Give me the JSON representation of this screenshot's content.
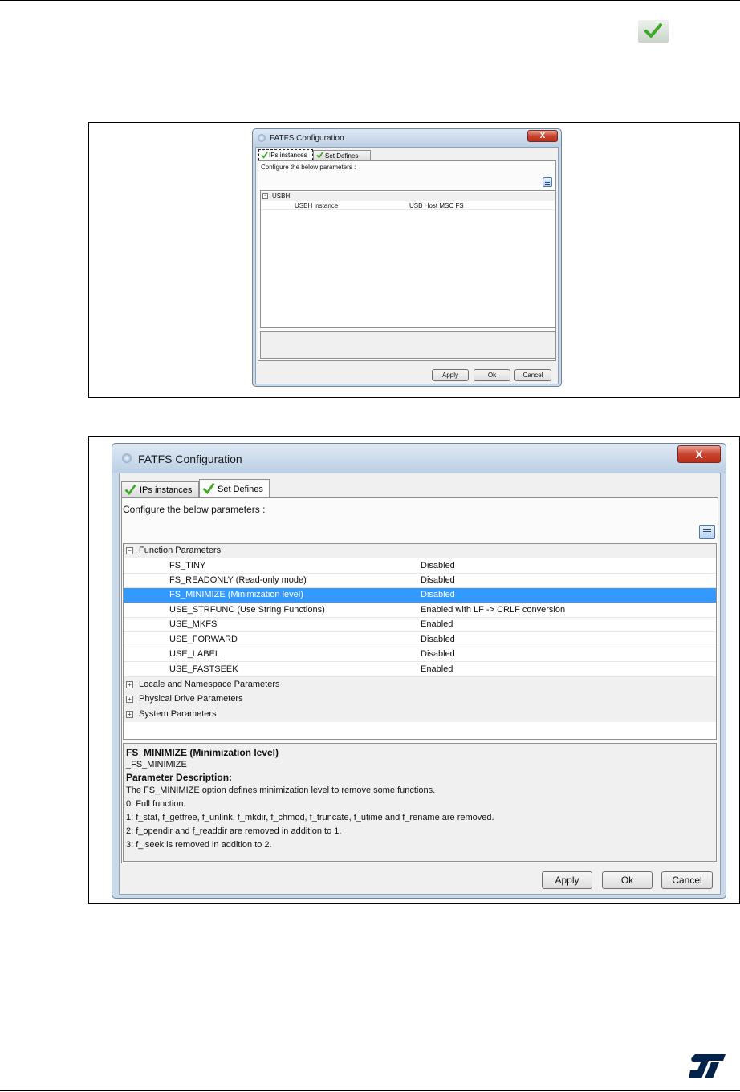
{
  "dialog": {
    "title": "FATFS Configuration",
    "close_glyph": "X",
    "tabs": [
      "IPs instances",
      "Set Defines"
    ],
    "subtitle": "Configure the below parameters :",
    "buttons": {
      "apply": "Apply",
      "ok": "Ok",
      "cancel": "Cancel"
    }
  },
  "figure1": {
    "active_tab": "IPs instances",
    "group": "USBH",
    "rows": [
      {
        "key": "USBH instance",
        "value": "USB Host MSC FS"
      }
    ]
  },
  "figure2": {
    "active_tab": "Set Defines",
    "group_expanded": "Function Parameters",
    "rows": [
      {
        "key": "FS_TINY",
        "value": "Disabled"
      },
      {
        "key": "FS_READONLY (Read-only mode)",
        "value": "Disabled"
      },
      {
        "key": "FS_MINIMIZE (Minimization level)",
        "value": "Disabled",
        "selected": true
      },
      {
        "key": "USE_STRFUNC (Use String Functions)",
        "value": "Enabled with LF -> CRLF conversion"
      },
      {
        "key": "USE_MKFS",
        "value": "Enabled"
      },
      {
        "key": "USE_FORWARD",
        "value": "Disabled"
      },
      {
        "key": "USE_LABEL",
        "value": "Disabled"
      },
      {
        "key": "USE_FASTSEEK",
        "value": "Enabled"
      }
    ],
    "collapsed_groups": [
      "Locale and Namespace Parameters",
      "Physical Drive Parameters",
      "System Parameters"
    ],
    "description": {
      "title": "FS_MINIMIZE (Minimization level)",
      "define": "_FS_MINIMIZE",
      "heading": "Parameter Description:",
      "lines": [
        "The FS_MINIMIZE option defines minimization level to remove some functions.",
        "0: Full function.",
        "1: f_stat, f_getfree, f_unlink, f_mkdir, f_chmod, f_truncate, f_utime and f_rename are removed.",
        "2: f_opendir and f_readdir are removed in addition to 1.",
        "3: f_lseek is removed in addition to 2."
      ]
    }
  },
  "icons": {
    "check": "check-icon",
    "collapse": "minus-box-icon",
    "expand": "plus-box-icon",
    "view_toggle": "list-view-icon",
    "logo": "st-logo"
  },
  "colors": {
    "selection": "#3399ff",
    "check_green": "#3fa82a",
    "st_blue": "#03234b"
  }
}
